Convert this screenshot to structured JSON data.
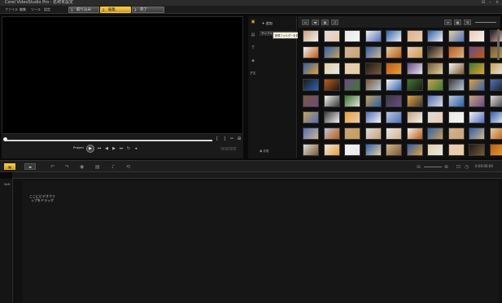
{
  "window": {
    "title": "Corel VideoStudio Pro - 名称未設定",
    "controls": [
      "⊟",
      "–",
      "×"
    ]
  },
  "menu": {
    "items": [
      "ファイル",
      "編集",
      "ツール",
      "設定"
    ]
  },
  "steps": [
    {
      "num": "1",
      "label": "取り込み"
    },
    {
      "num": "2",
      "label": "編集"
    },
    {
      "num": "3",
      "label": "完了"
    }
  ],
  "player": {
    "project_label": "Project",
    "play_icon": "play-icon"
  },
  "library": {
    "add_label": "追加",
    "tooltip": "新規フォルダーを追加",
    "tree_item": "サンプル",
    "bottom_label": "参照"
  },
  "timeline": {
    "timecode": "0:00:00:00",
    "track_label": "Split",
    "drop_hint": "ここにビデオクリップをドラッグ"
  },
  "colors": {
    "accent": "#e8b51c",
    "bg": "#0a0a0a"
  }
}
